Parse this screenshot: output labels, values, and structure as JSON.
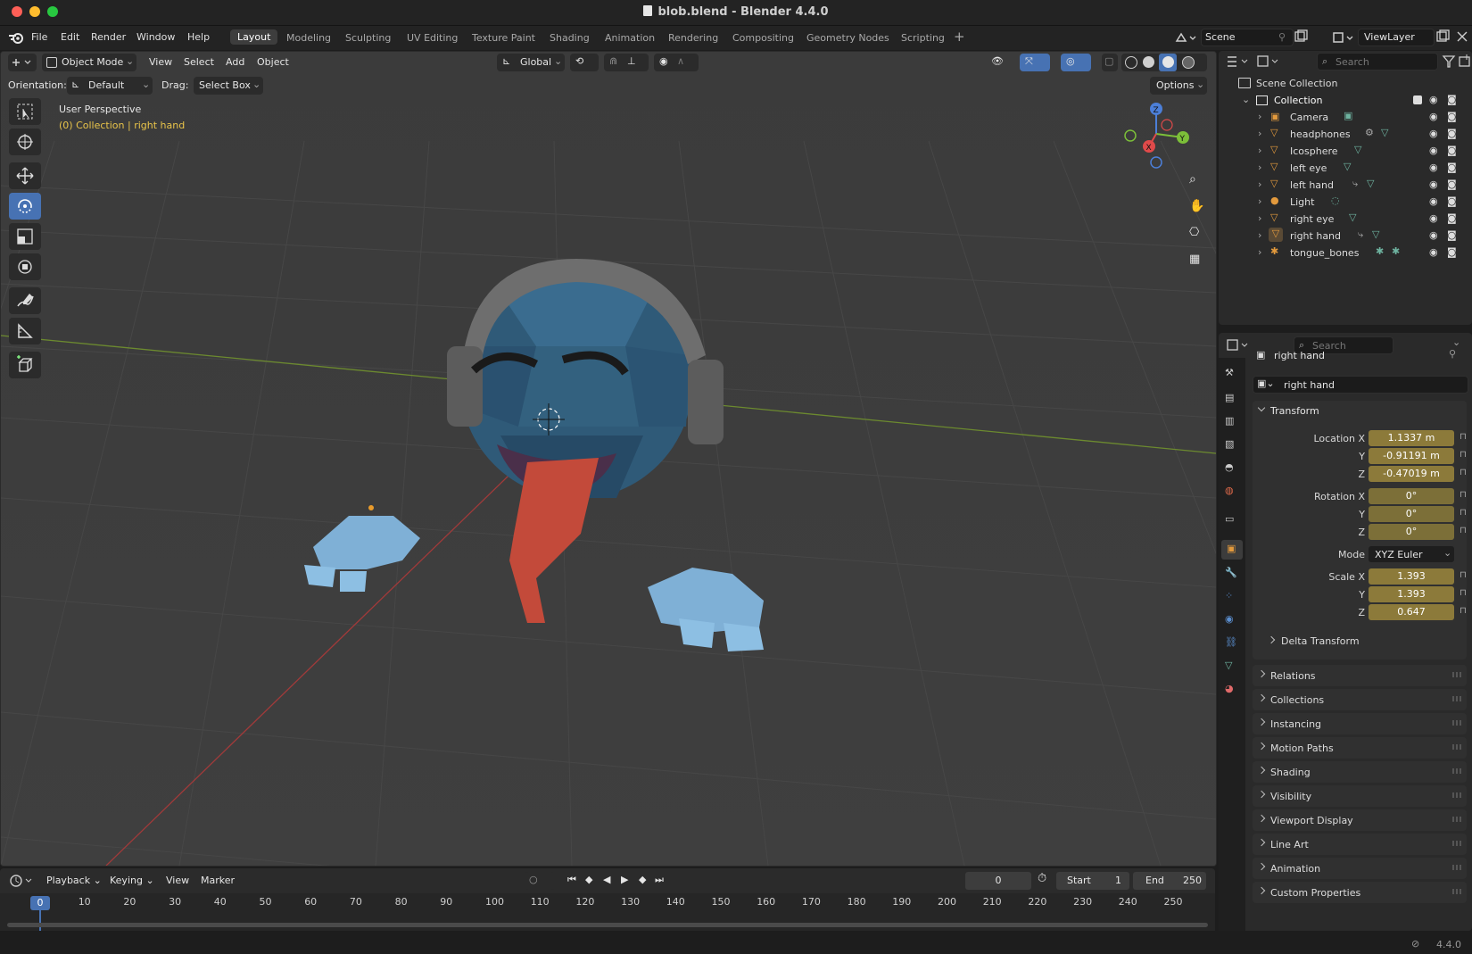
{
  "window": {
    "title": "blob.blend - Blender 4.4.0"
  },
  "menubar": {
    "file": "File",
    "edit": "Edit",
    "render": "Render",
    "window": "Window",
    "help": "Help"
  },
  "workspaces": [
    "Layout",
    "Modeling",
    "Sculpting",
    "UV Editing",
    "Texture Paint",
    "Shading",
    "Animation",
    "Rendering",
    "Compositing",
    "Geometry Nodes",
    "Scripting"
  ],
  "scene": {
    "name": "Scene",
    "view_layer": "ViewLayer"
  },
  "viewport_header": {
    "mode": "Object Mode",
    "view": "View",
    "select": "Select",
    "add": "Add",
    "object": "Object",
    "transform_orientation": "Global",
    "orientation_label": "Orientation:",
    "orientation_value": "Default",
    "drag_label": "Drag:",
    "drag_value": "Select Box",
    "options": "Options"
  },
  "viewport": {
    "perspective": "User Perspective",
    "collection_info": "(0) Collection",
    "active_object": "right hand"
  },
  "outliner": {
    "search_placeholder": "Search",
    "scene_collection": "Scene Collection",
    "collection": "Collection",
    "items": [
      {
        "name": "Camera",
        "type": "camera"
      },
      {
        "name": "headphones",
        "type": "mesh"
      },
      {
        "name": "Icosphere",
        "type": "mesh"
      },
      {
        "name": "left eye",
        "type": "mesh"
      },
      {
        "name": "left hand",
        "type": "mesh"
      },
      {
        "name": "Light",
        "type": "light"
      },
      {
        "name": "right eye",
        "type": "mesh"
      },
      {
        "name": "right hand",
        "type": "mesh",
        "selected": true
      },
      {
        "name": "tongue_bones",
        "type": "armature"
      }
    ]
  },
  "properties": {
    "search_placeholder": "Search",
    "object_name": "right hand",
    "datablock_name": "right hand",
    "transform": {
      "header": "Transform",
      "location_label": "Location X",
      "location": [
        "1.1337 m",
        "-0.91191 m",
        "-0.47019 m"
      ],
      "rotation_label": "Rotation X",
      "rotation": [
        "0°",
        "0°",
        "0°"
      ],
      "mode_label": "Mode",
      "mode": "XYZ Euler",
      "scale_label": "Scale X",
      "scale": [
        "1.393",
        "1.393",
        "0.647"
      ],
      "axis_y": "Y",
      "axis_z": "Z",
      "delta": "Delta Transform"
    },
    "panels": [
      "Relations",
      "Collections",
      "Instancing",
      "Motion Paths",
      "Shading",
      "Visibility",
      "Viewport Display",
      "Line Art",
      "Animation",
      "Custom Properties"
    ]
  },
  "timeline": {
    "playback": "Playback",
    "keying": "Keying",
    "view": "View",
    "marker": "Marker",
    "current_frame": "0",
    "start_label": "Start",
    "start": "1",
    "end_label": "End",
    "end": "250",
    "ticks": [
      "0",
      "10",
      "20",
      "30",
      "40",
      "50",
      "60",
      "70",
      "80",
      "90",
      "100",
      "110",
      "120",
      "130",
      "140",
      "150",
      "160",
      "170",
      "180",
      "190",
      "200",
      "210",
      "220",
      "230",
      "240",
      "250"
    ]
  },
  "statusbar": {
    "version": "4.4.0"
  },
  "colors": {
    "accent": "#4772b3",
    "field_animated": "#8c7a3a",
    "selection_text": "#e9c44a"
  }
}
